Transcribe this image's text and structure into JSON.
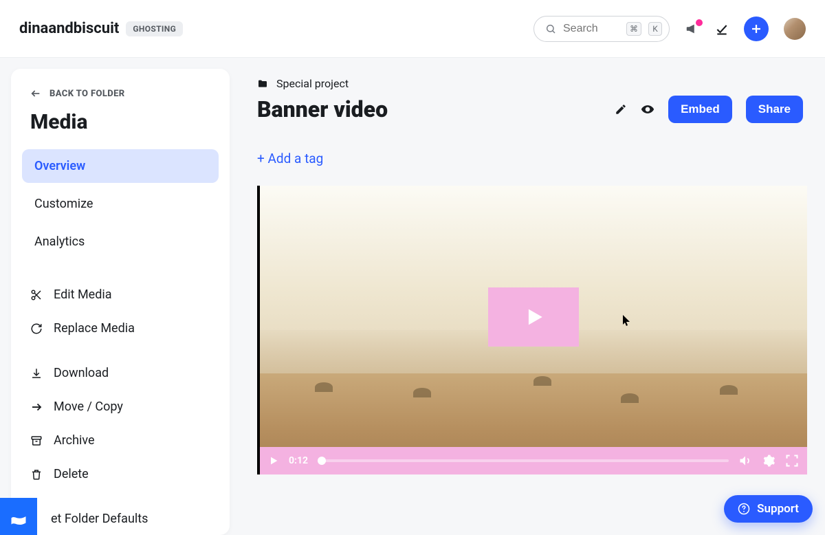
{
  "header": {
    "brand": "dinaandbiscuit",
    "badge": "GHOSTING",
    "searchPlaceholder": "Search",
    "kbd1": "⌘",
    "kbd2": "K"
  },
  "sidebar": {
    "back": "BACK TO FOLDER",
    "title": "Media",
    "tabs": {
      "overview": "Overview",
      "customize": "Customize",
      "analytics": "Analytics"
    },
    "actions": {
      "edit": "Edit Media",
      "replace": "Replace Media",
      "download": "Download",
      "move": "Move / Copy",
      "archive": "Archive",
      "delete": "Delete",
      "folderdefaults": "et Folder Defaults"
    }
  },
  "main": {
    "folder": "Special project",
    "title": "Banner video",
    "embed": "Embed",
    "share": "Share",
    "addTag": "+ Add a tag",
    "time": "0:12"
  },
  "support": "Support"
}
